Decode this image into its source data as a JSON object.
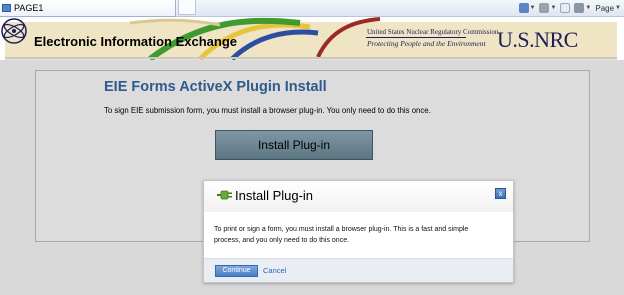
{
  "browser": {
    "tab_title": "PAGE1",
    "toolbar": {
      "home_icon": "home-icon",
      "feeds_icon": "rss-feed-icon",
      "mail_icon": "read-mail-icon",
      "print_icon": "printer-icon",
      "page_label": "Page"
    }
  },
  "header": {
    "site_title": "Electronic Information Exchange",
    "agency_name": "United States Nuclear Regulatory Commission",
    "agency_tagline": "Protecting People and the Environment",
    "agency_logo_text": "U.S.NRC",
    "colors": {
      "banner": "#efe4c4",
      "swoosh_green": "#3f9a2f",
      "swoosh_blue": "#2d4ea0",
      "swoosh_yellow": "#e8c43a",
      "swoosh_red": "#9a2b24"
    }
  },
  "main": {
    "title": "EIE Forms ActiveX Plugin Install",
    "description": "To sign EIE submission form, you must install a browser plug-in.  You only need to do this once.",
    "install_button_label": "Install Plug-in",
    "title_color": "#2f5a8e"
  },
  "dialog": {
    "title": "Install Plug-in",
    "plug_icon": "plug-icon",
    "close_label": "x",
    "body_line1": "To print or sign a form, you must install a browser plug-in. This is a fast and simple",
    "body_line2": "process, and you only need to do this once.",
    "continue_label": "Continue",
    "cancel_label": "Cancel"
  }
}
